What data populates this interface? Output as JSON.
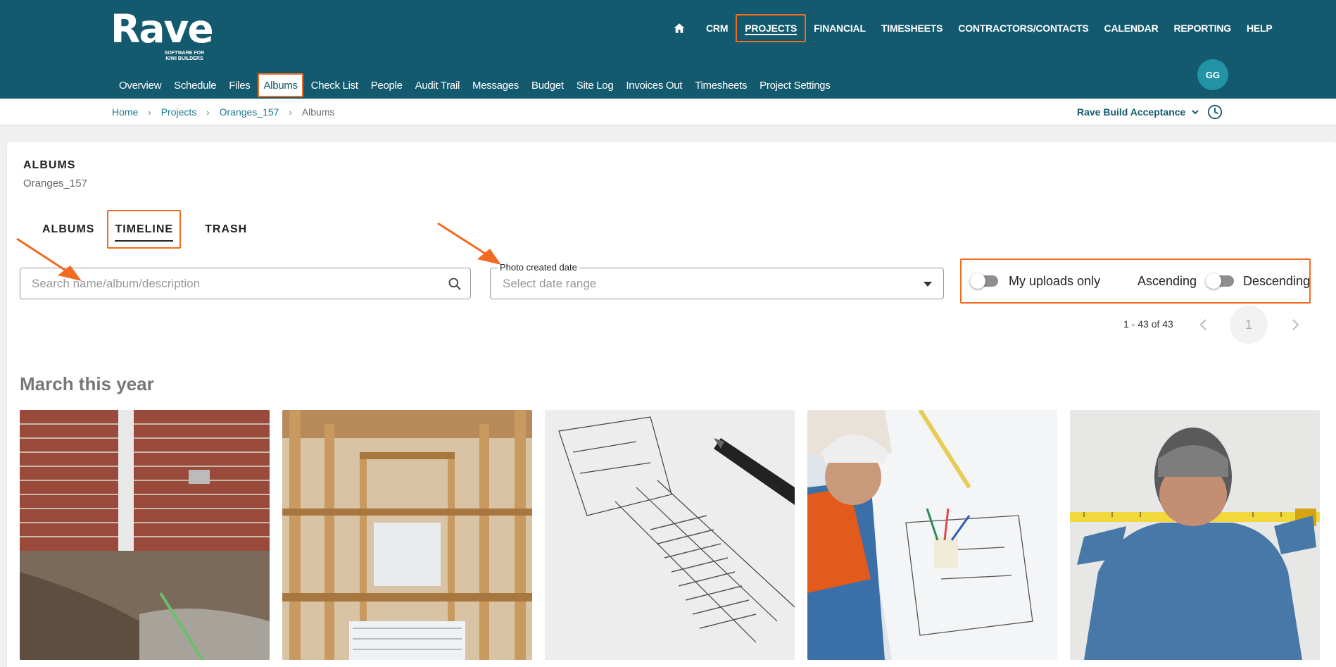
{
  "brand": {
    "name": "Rave",
    "tagline": "SOFTWARE FOR KIWI BUILDERS"
  },
  "main_nav": {
    "items": [
      {
        "label": "CRM"
      },
      {
        "label": "PROJECTS"
      },
      {
        "label": "FINANCIAL"
      },
      {
        "label": "TIMESHEETS"
      },
      {
        "label": "CONTRACTORS/CONTACTS"
      },
      {
        "label": "CALENDAR"
      },
      {
        "label": "REPORTING"
      },
      {
        "label": "HELP"
      }
    ]
  },
  "sub_nav": {
    "items": [
      {
        "label": "Overview"
      },
      {
        "label": "Schedule"
      },
      {
        "label": "Files"
      },
      {
        "label": "Albums"
      },
      {
        "label": "Check List"
      },
      {
        "label": "People"
      },
      {
        "label": "Audit Trail"
      },
      {
        "label": "Messages"
      },
      {
        "label": "Budget"
      },
      {
        "label": "Site Log"
      },
      {
        "label": "Invoices Out"
      },
      {
        "label": "Timesheets"
      },
      {
        "label": "Project Settings"
      }
    ]
  },
  "user": {
    "initials": "GG"
  },
  "breadcrumb": {
    "items": [
      {
        "label": "Home"
      },
      {
        "label": "Projects"
      },
      {
        "label": "Oranges_157"
      },
      {
        "label": "Albums"
      }
    ],
    "separator": "›"
  },
  "company_selector": {
    "label": "Rave Build Acceptance"
  },
  "page": {
    "title": "ALBUMS",
    "subtitle": "Oranges_157",
    "tabs": [
      {
        "label": "ALBUMS"
      },
      {
        "label": "TIMELINE"
      },
      {
        "label": "TRASH"
      }
    ]
  },
  "filters": {
    "search_placeholder": "Search name/album/description",
    "date_label": "Photo created date",
    "date_placeholder": "Select date range",
    "my_uploads_label": "My uploads only",
    "ascending_label": "Ascending",
    "descending_label": "Descending",
    "my_uploads_on": false,
    "sort_descending": false
  },
  "pagination": {
    "range_text": "1 - 43 of 43",
    "current_page": "1"
  },
  "timeline": {
    "section_title": "March this year",
    "photos": [
      {
        "subject": "brick-wall-foundation"
      },
      {
        "subject": "timber-framing"
      },
      {
        "subject": "blueprint-with-pen"
      },
      {
        "subject": "workers-reviewing-plans"
      },
      {
        "subject": "man-with-tape-measure"
      }
    ]
  },
  "colors": {
    "header_bg": "#145a6e",
    "accent_orange": "#f26b21",
    "link": "#1d7a90",
    "avatar_bg": "#2293a7"
  }
}
